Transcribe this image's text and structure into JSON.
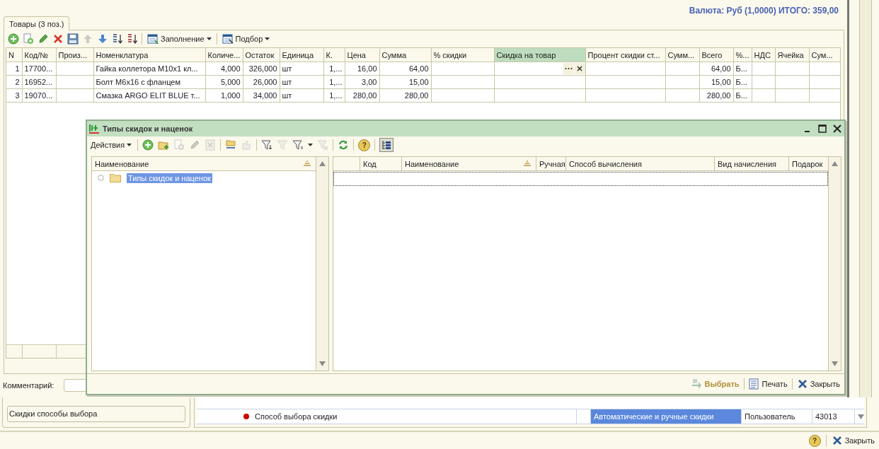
{
  "summary": "Валюта: Руб (1,0000) ИТОГО: 359,00",
  "tabs": [
    {
      "label": "Товары (3 поз.)",
      "selected": true
    }
  ],
  "toolbar": [
    {
      "kind": "add",
      "disabled": false
    },
    {
      "kind": "copy",
      "disabled": false
    },
    {
      "kind": "edit",
      "disabled": false
    },
    {
      "kind": "delete",
      "disabled": false
    },
    {
      "kind": "save",
      "disabled": false
    },
    {
      "kind": "up",
      "disabled": true
    },
    {
      "kind": "down",
      "disabled": false
    },
    {
      "kind": "sort-asc",
      "disabled": false
    },
    {
      "kind": "sort-desc",
      "disabled": false
    },
    {
      "kind": "separator"
    },
    {
      "kind": "fill-menu",
      "label": "Заполнение"
    },
    {
      "kind": "separator"
    },
    {
      "kind": "pick-menu",
      "label": "Подбор"
    }
  ],
  "table": {
    "columns": [
      {
        "label": "N",
        "kind": "number",
        "selected": false
      },
      {
        "label": "Код/№",
        "kind": "text",
        "selected": false
      },
      {
        "label": "Произ...",
        "kind": "text",
        "selected": false
      },
      {
        "label": "Номенклатура",
        "kind": "text",
        "selected": false
      },
      {
        "label": "Количе...",
        "kind": "number",
        "selected": false
      },
      {
        "label": "Остаток",
        "kind": "number",
        "selected": false
      },
      {
        "label": "Единица",
        "kind": "text",
        "selected": false
      },
      {
        "label": "К.",
        "kind": "number",
        "selected": false
      },
      {
        "label": "Цена",
        "kind": "number",
        "selected": false
      },
      {
        "label": "Сумма",
        "kind": "number",
        "selected": false
      },
      {
        "label": "% скидки",
        "kind": "number",
        "selected": false
      },
      {
        "label": "Скидка на товар",
        "kind": "text",
        "selected": true
      },
      {
        "label": "Процент скидки ст...",
        "kind": "number",
        "selected": false
      },
      {
        "label": "Сумм...",
        "kind": "number",
        "selected": false
      },
      {
        "label": "Всего",
        "kind": "number",
        "selected": false
      },
      {
        "label": "%...",
        "kind": "text",
        "selected": false
      },
      {
        "label": "НДС",
        "kind": "number",
        "selected": false
      },
      {
        "label": "Ячейка",
        "kind": "text",
        "selected": false
      },
      {
        "label": "Сум...",
        "kind": "number",
        "selected": false
      }
    ],
    "rows": [
      {
        "editing": true,
        "cells": [
          "1",
          "17700...",
          null,
          "Гайка коллетора М10х1 кл...",
          "4,000",
          "326,000",
          "шт",
          "1,...",
          "16,00",
          "64,00",
          null,
          null,
          null,
          null,
          "64,00",
          "Б...",
          null,
          null,
          null
        ]
      },
      {
        "editing": false,
        "cells": [
          "2",
          "16952...",
          null,
          "Болт М6х16 с фланцем",
          "5,000",
          "26,000",
          "шт",
          "1,...",
          "3,00",
          "15,00",
          null,
          null,
          null,
          null,
          "15,00",
          "Б...",
          null,
          null,
          null
        ]
      },
      {
        "editing": false,
        "cells": [
          "3",
          "19070...",
          null,
          "Смазка ARGO ELIT BLUE т...",
          "1,000",
          "34,000",
          "шт",
          "1,...",
          "280,00",
          "280,00",
          null,
          null,
          null,
          null,
          "280,00",
          "Б...",
          null,
          null,
          null
        ]
      }
    ]
  },
  "comment": {
    "label": "Комментарий:"
  },
  "dialog": {
    "title": "Типы скидок и наценок",
    "toolbar": [
      {
        "kind": "menu",
        "label": "Действия"
      },
      {
        "kind": "separator"
      },
      {
        "kind": "add",
        "disabled": false
      },
      {
        "kind": "add-folder",
        "disabled": false
      },
      {
        "kind": "copy",
        "disabled": true
      },
      {
        "kind": "edit",
        "disabled": true
      },
      {
        "kind": "delete-box",
        "disabled": true
      },
      {
        "kind": "separator"
      },
      {
        "kind": "to-folder",
        "disabled": false
      },
      {
        "kind": "from-folder",
        "disabled": true
      },
      {
        "kind": "separator"
      },
      {
        "kind": "filter-set",
        "disabled": false
      },
      {
        "kind": "filter",
        "disabled": true
      },
      {
        "kind": "filter-menu",
        "disabled": false
      },
      {
        "kind": "filter-clear",
        "disabled": true
      },
      {
        "kind": "separator"
      },
      {
        "kind": "refresh",
        "disabled": false
      },
      {
        "kind": "separator"
      },
      {
        "kind": "help",
        "label": "?"
      },
      {
        "kind": "separator"
      },
      {
        "kind": "tree",
        "pressed": true
      }
    ],
    "tree": {
      "column": "Наименование",
      "items": [
        {
          "label": "Типы скидок и наценок",
          "selected": true
        }
      ]
    },
    "list": {
      "columns": [
        "Код",
        "Наименование",
        "Ручная",
        "Способ вычисления",
        "Вид начисления",
        "Подарок"
      ]
    },
    "buttons": [
      {
        "kind": "choose",
        "label": "Выбрать"
      },
      {
        "kind": "print",
        "label": "Печать"
      },
      {
        "kind": "close",
        "label": "Закрыть"
      }
    ]
  },
  "settings": {
    "field": "Скидки способы выбора",
    "row": {
      "color": "#cc0000",
      "cells": [
        {
          "text": "Способ выбора скидки",
          "selected": false
        },
        {
          "text": "Автоматические и ручные скидки",
          "selected": true
        },
        {
          "text": "Пользователь",
          "selected": false
        },
        {
          "text": "43013",
          "selected": false
        }
      ]
    }
  },
  "footer": {
    "help": "?",
    "close": "Закрыть"
  }
}
